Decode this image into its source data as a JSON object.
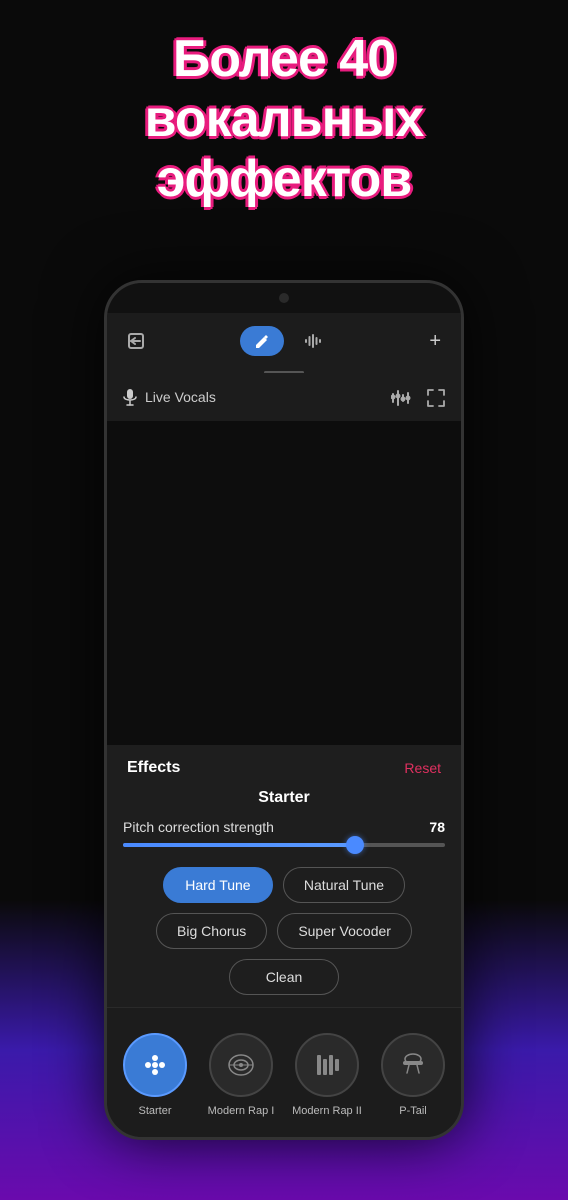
{
  "hero": {
    "title": "Более 40 вокальных эффектов"
  },
  "nav": {
    "back_icon": "⬅",
    "tab_edit_icon": "✏",
    "tab_audio_icon": "audio",
    "plus_icon": "+",
    "divider": true
  },
  "vocals_bar": {
    "mic_label": "Live Vocals",
    "eq_icon": "equalizer",
    "expand_icon": "expand"
  },
  "effects": {
    "section_title": "Effects",
    "reset_label": "Reset",
    "preset_name": "Starter",
    "pitch": {
      "label": "Pitch correction strength",
      "value": "78",
      "fill_percent": 72
    },
    "buttons": [
      {
        "id": "hard-tune",
        "label": "Hard Tune",
        "active": true
      },
      {
        "id": "natural-tune",
        "label": "Natural Tune",
        "active": false
      },
      {
        "id": "big-chorus",
        "label": "Big Chorus",
        "active": false
      },
      {
        "id": "super-vocoder",
        "label": "Super Vocoder",
        "active": false
      },
      {
        "id": "clean",
        "label": "Clean",
        "active": false
      }
    ]
  },
  "presets": [
    {
      "id": "starter",
      "label": "Starter",
      "icon": "grid",
      "active": true
    },
    {
      "id": "modern-rap-1",
      "label": "Modern Rap I",
      "icon": "face",
      "active": false
    },
    {
      "id": "modern-rap-2",
      "label": "Modern Rap II",
      "icon": "bars",
      "active": false
    },
    {
      "id": "p-tail",
      "label": "P-Tail",
      "icon": "hat",
      "active": false
    }
  ]
}
